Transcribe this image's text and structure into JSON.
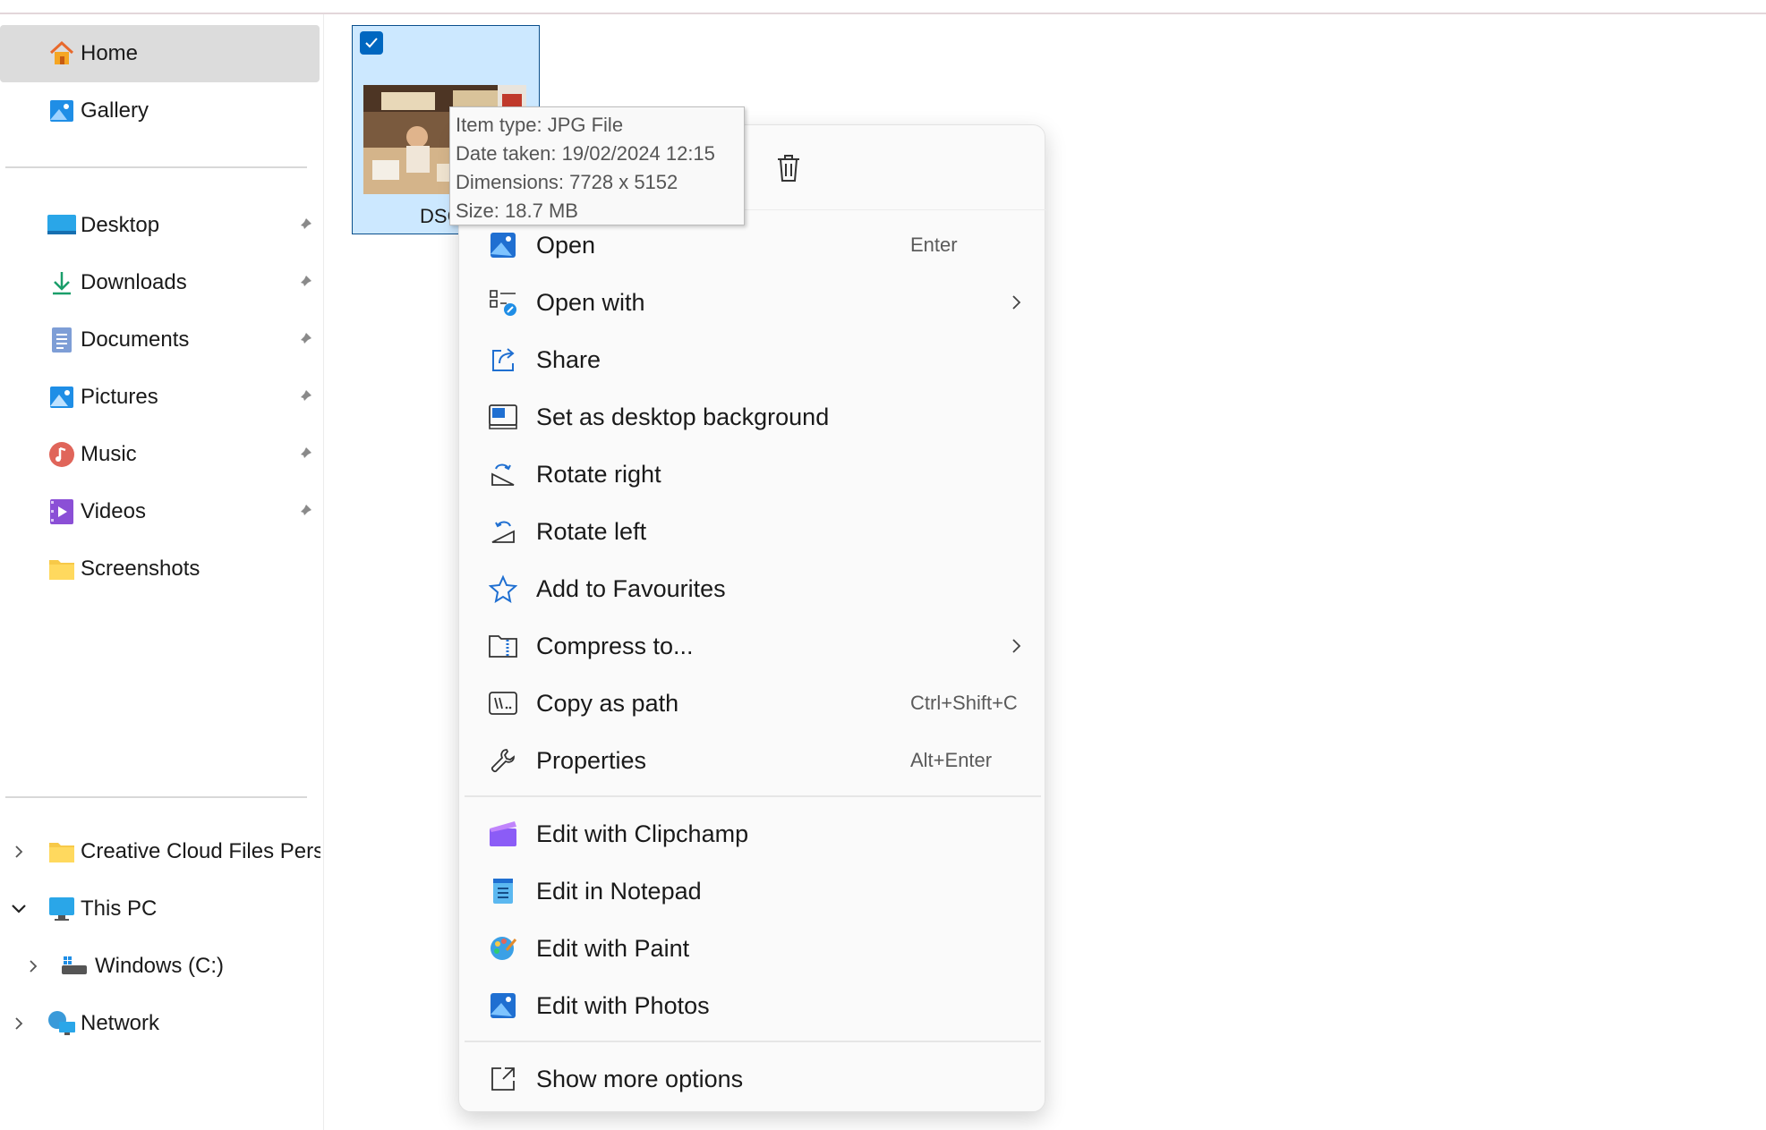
{
  "sidebar": {
    "quick": [
      {
        "label": "Home"
      },
      {
        "label": "Gallery"
      }
    ],
    "pinned": [
      {
        "label": "Desktop"
      },
      {
        "label": "Downloads"
      },
      {
        "label": "Documents"
      },
      {
        "label": "Pictures"
      },
      {
        "label": "Music"
      },
      {
        "label": "Videos"
      },
      {
        "label": "Screenshots"
      }
    ],
    "tree": [
      {
        "label": "Creative Cloud Files Perso"
      },
      {
        "label": "This PC"
      },
      {
        "label": "Windows (C:)"
      },
      {
        "label": "Network"
      }
    ]
  },
  "file": {
    "name": "DSCF"
  },
  "tooltip": {
    "lines": [
      "Item type: JPG File",
      "Date taken: 19/02/2024 12:15",
      "Dimensions: 7728 x 5152",
      "Size: 18.7 MB"
    ]
  },
  "menu": {
    "items": [
      {
        "label": "Open",
        "shortcut": "Enter"
      },
      {
        "label": "Open with"
      },
      {
        "label": "Share"
      },
      {
        "label": "Set as desktop background"
      },
      {
        "label": "Rotate right"
      },
      {
        "label": "Rotate left"
      },
      {
        "label": "Add to Favourites"
      },
      {
        "label": "Compress to..."
      },
      {
        "label": "Copy as path",
        "shortcut": "Ctrl+Shift+C"
      },
      {
        "label": "Properties",
        "shortcut": "Alt+Enter"
      }
    ],
    "apps": [
      {
        "label": "Edit with Clipchamp"
      },
      {
        "label": "Edit in Notepad"
      },
      {
        "label": "Edit with Paint"
      },
      {
        "label": "Edit with Photos"
      }
    ],
    "more": {
      "label": "Show more options"
    }
  },
  "colors": {
    "accent": "#0067c0",
    "selection": "#cce8ff"
  }
}
